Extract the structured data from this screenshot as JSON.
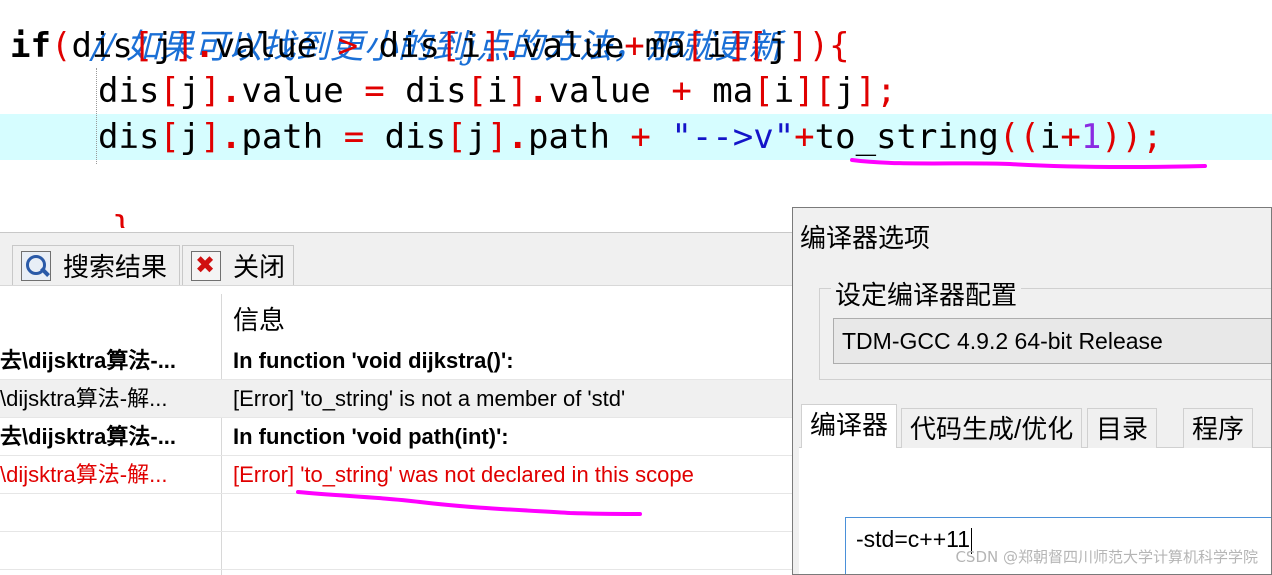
{
  "editor": {
    "comment_line": "// 如果可以找到更小的到j点的方法，那就更新",
    "if_line": {
      "kw": "if",
      "p1": "(",
      "a": "dis",
      "b1": "[",
      "j": "j",
      "b2": "]",
      "dot": ".",
      "v": "value",
      "gt": " > ",
      "a2": "dis",
      "b3": "[",
      "i": "i",
      "b4": "]",
      "dot2": ".",
      "v2": "value",
      "plus": "+",
      "ma": "ma",
      "b5": "[",
      "i2": "i",
      "b6": "][",
      "j2": "j",
      "b7": "]",
      "p2": ")",
      "brace": "{"
    },
    "assign_line": {
      "a": "dis",
      "b1": "[",
      "j": "j",
      "b2": "]",
      "dot": ".",
      "v": "value",
      "eq": " = ",
      "a2": "dis",
      "b3": "[",
      "i": "i",
      "b4": "]",
      "dot2": ".",
      "v2": "value",
      "plus": " + ",
      "ma": "ma",
      "b5": "[",
      "i2": "i",
      "b6": "][",
      "j2": "j",
      "b7": "]",
      "semi": ";"
    },
    "path_line": {
      "a": "dis",
      "b1": "[",
      "j": "j",
      "b2": "]",
      "dot": ".",
      "p": "path",
      "eq": " = ",
      "a2": "dis",
      "b3": "[",
      "j2": "j",
      "b4": "]",
      "dot2": ".",
      "p2": "path",
      "plus": " + ",
      "str": "\"-->v\"",
      "plus2": "+",
      "fn": "to_string",
      "pp": "((",
      "i": "i",
      "plus3": "+",
      "one": "1",
      "pc": "))",
      "semi": ";"
    },
    "close_brace": "}"
  },
  "panel": {
    "tabs": [
      {
        "label": "搜索结果",
        "icon": "search-results-icon"
      },
      {
        "label": "关闭",
        "icon": "close-icon"
      }
    ],
    "column_header": "信息",
    "rows": [
      {
        "file": "去\\dijsktra算法-...",
        "message": "In function 'void dijkstra()':",
        "style": "bold"
      },
      {
        "file": "\\dijsktra算法-解...",
        "message": "[Error] 'to_string' is not a member of 'std'",
        "style": "normal"
      },
      {
        "file": "去\\dijsktra算法-...",
        "message": "In function 'void path(int)':",
        "style": "bold"
      },
      {
        "file": "\\dijsktra算法-解...",
        "message": "[Error] 'to_string' was not declared in this scope",
        "style": "error"
      }
    ]
  },
  "dialog": {
    "title": "编译器选项",
    "group_label": "设定编译器配置",
    "compiler_profile": "TDM-GCC 4.9.2 64-bit Release",
    "tabs": [
      "编译器",
      "代码生成/优化",
      "目录",
      "程序"
    ],
    "active_tab": "编译器",
    "options_input_value": "-std=c++11"
  },
  "watermark": "CSDN @郑朝督四川师范大学计算机科学学院",
  "colors": {
    "highlight_line": "#d6fdff",
    "error_text": "#e00000",
    "annotation_magenta": "#ff00ff"
  }
}
